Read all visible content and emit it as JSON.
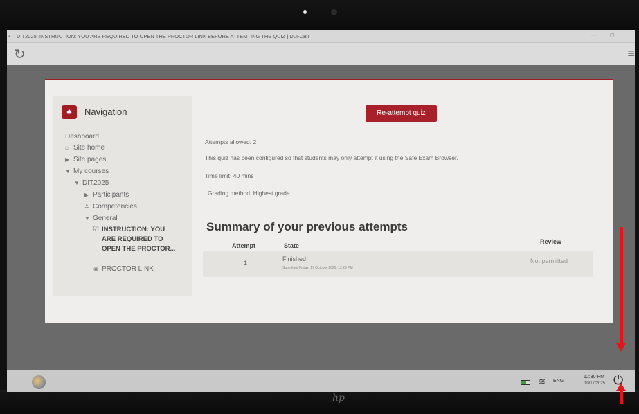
{
  "window": {
    "title": "DIT2025: INSTRUCTION: YOU ARE REQUIRED TO OPEN THE PROCTOR LINK BEFORE ATTEMTING THE QUIZ | DLI-CBT",
    "maximize_glyph": "□",
    "minimize_glyph": "—"
  },
  "toolbar": {
    "reload_icon": "reload-icon",
    "menu_icon": "menu-icon"
  },
  "navigation": {
    "title": "Navigation",
    "items": [
      {
        "label": "Dashboard",
        "icon": ""
      },
      {
        "label": "Site home",
        "icon": "home-icon"
      },
      {
        "label": "Site pages",
        "icon": "chevron-right-icon"
      },
      {
        "label": "My courses",
        "icon": "chevron-down-icon"
      },
      {
        "label": "DIT2025",
        "icon": "chevron-down-icon"
      },
      {
        "label": "Participants",
        "icon": "chevron-right-icon"
      },
      {
        "label": "Competencies",
        "icon": "competencies-icon"
      },
      {
        "label": "General",
        "icon": "chevron-down-icon"
      },
      {
        "label": "INSTRUCTION: YOU ARE REQUIRED TO OPEN THE PROCTOR...",
        "icon": "page-icon"
      },
      {
        "label": "PROCTOR LINK",
        "icon": "link-icon"
      }
    ]
  },
  "quiz": {
    "reattempt_button": "Re-attempt quiz",
    "attempts_allowed": "Attempts allowed: 2",
    "seb_notice": "This quiz has been configured so that students may only attempt it using the Safe Exam Browser.",
    "time_limit": "Time limit: 40 mins",
    "grading_method": "Grading method: Highest grade"
  },
  "summary": {
    "heading": "Summary of your previous attempts",
    "columns": [
      "Attempt",
      "State",
      "Review"
    ],
    "rows": [
      {
        "attempt": "1",
        "state": "Finished",
        "submitted": "Submitted Friday, 17 October 2025, 12:29 PM",
        "review": "Not permitted"
      }
    ]
  },
  "taskbar": {
    "language": "ENG",
    "time": "12:30 PM",
    "date": "10/17/2025"
  },
  "device": {
    "brand": "hp"
  }
}
